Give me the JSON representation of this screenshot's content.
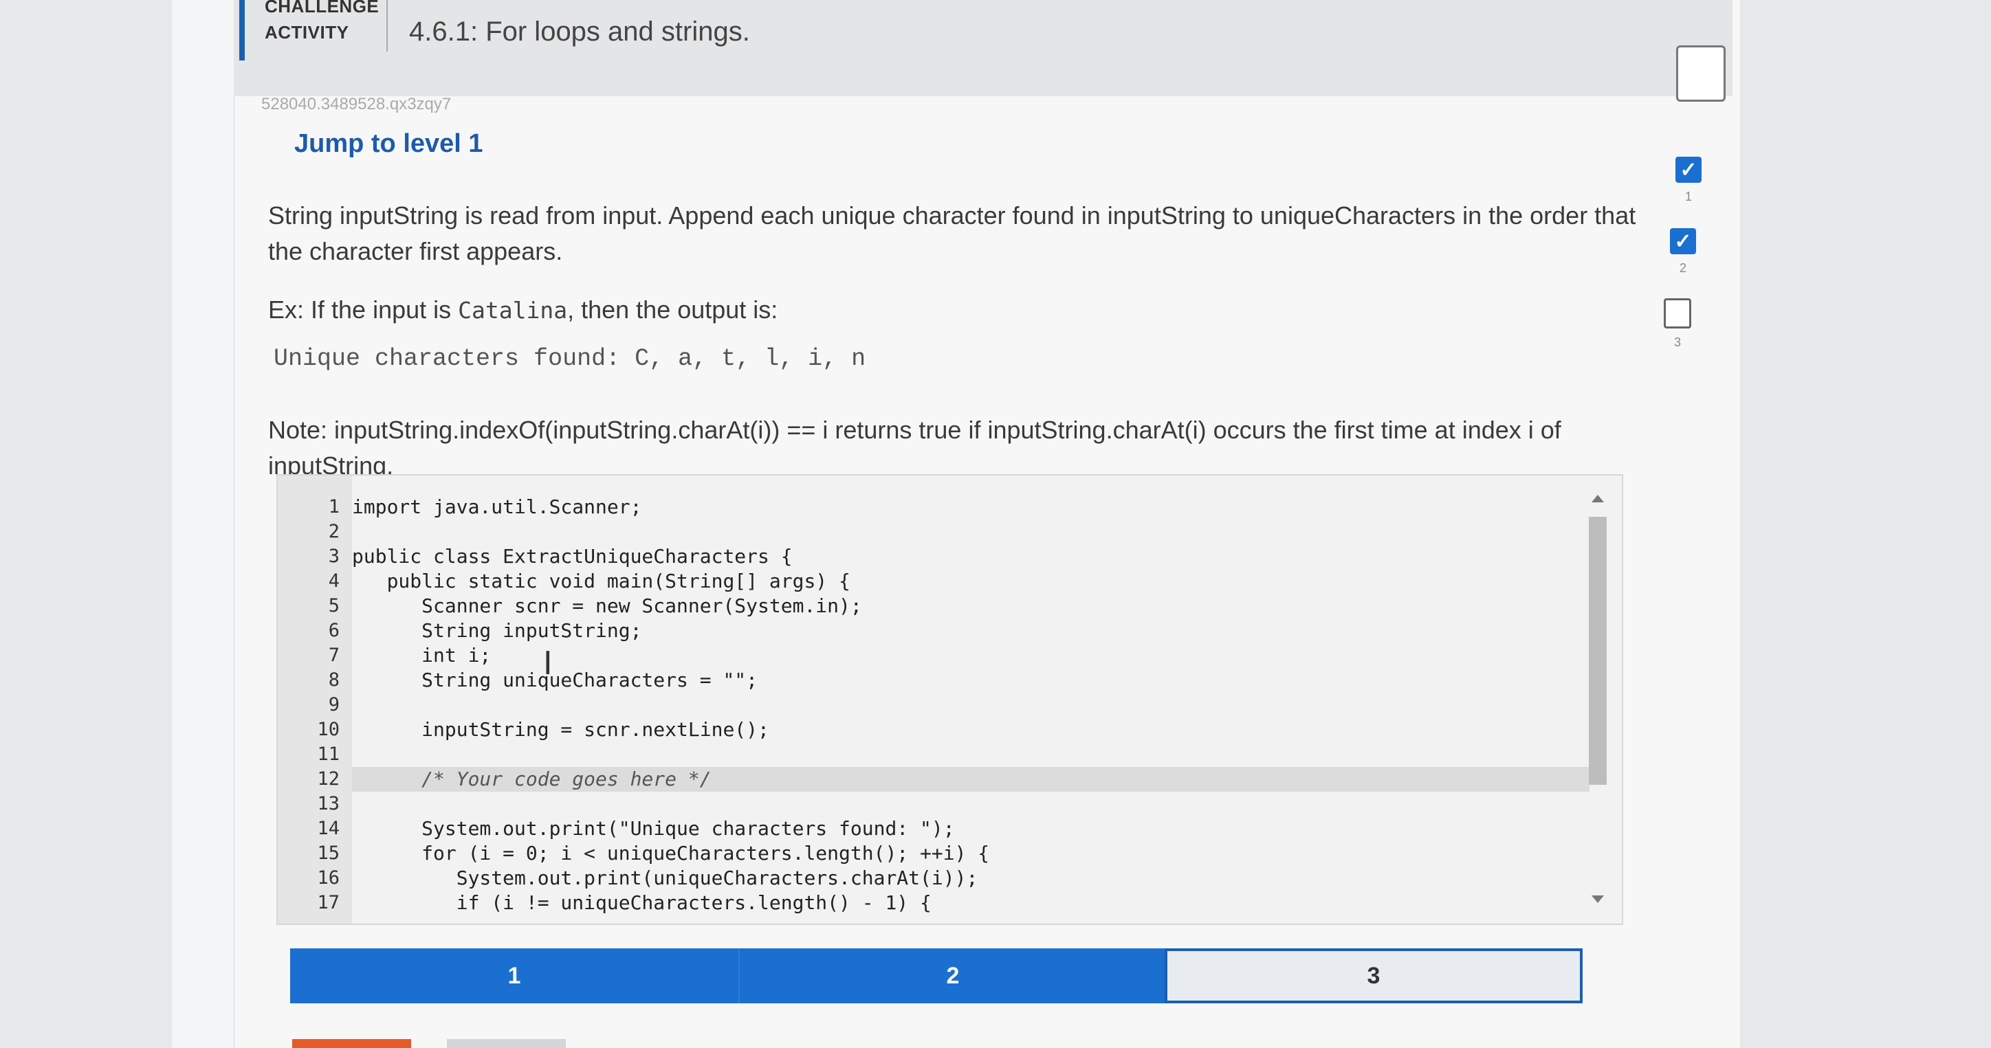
{
  "header": {
    "activity_label": "CHALLENGE\nACTIVITY",
    "title": "4.6.1: For loops and strings."
  },
  "activity_id": "528040.3489528.qx3zqy7",
  "level_title": "Jump to level 1",
  "instructions": {
    "para1": "String inputString is read from input. Append each unique character found in inputString to uniqueCharacters in the order that the character first appears.",
    "ex_prefix": "Ex: If the input is ",
    "ex_input": "Catalina",
    "ex_suffix": ", then the output is:",
    "sample_output": "Unique characters found: C, a, t, l, i, n",
    "note": "Note: inputString.indexOf(inputString.charAt(i)) == i returns true if inputString.charAt(i) occurs the first time at index i of inputString."
  },
  "code_lines": [
    {
      "n": "1",
      "text": "import java.util.Scanner;"
    },
    {
      "n": "2",
      "text": ""
    },
    {
      "n": "3",
      "text": "public class ExtractUniqueCharacters {"
    },
    {
      "n": "4",
      "text": "   public static void main(String[] args) {"
    },
    {
      "n": "5",
      "text": "      Scanner scnr = new Scanner(System.in);"
    },
    {
      "n": "6",
      "text": "      String inputString;"
    },
    {
      "n": "7",
      "text": "      int i;"
    },
    {
      "n": "8",
      "text": "      String uniqueCharacters = \"\";"
    },
    {
      "n": "9",
      "text": ""
    },
    {
      "n": "10",
      "text": "      inputString = scnr.nextLine();"
    },
    {
      "n": "11",
      "text": ""
    },
    {
      "n": "12",
      "text": "      /* Your code goes here */"
    },
    {
      "n": "13",
      "text": ""
    },
    {
      "n": "14",
      "text": "      System.out.print(\"Unique characters found: \");"
    },
    {
      "n": "15",
      "text": "      for (i = 0; i < uniqueCharacters.length(); ++i) {"
    },
    {
      "n": "16",
      "text": "         System.out.print(uniqueCharacters.charAt(i));"
    },
    {
      "n": "17",
      "text": "         if (i != uniqueCharacters.length() - 1) {"
    }
  ],
  "level_tabs": [
    "1",
    "2",
    "3"
  ],
  "side_levels": [
    {
      "num": "1",
      "done": true
    },
    {
      "num": "2",
      "done": true
    },
    {
      "num": "3",
      "done": false
    }
  ],
  "icons": {
    "check": "✓",
    "ibeam": "I"
  },
  "colors": {
    "accent": "#1b6fd1",
    "level_title": "#1c5baa"
  }
}
